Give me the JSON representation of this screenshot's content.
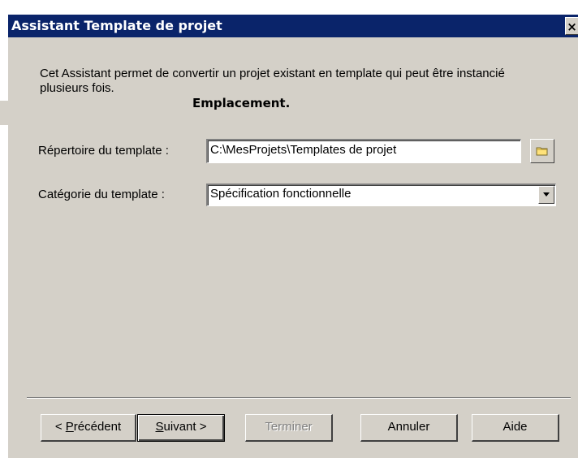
{
  "window": {
    "title": "Assistant Template de projet",
    "close_label": "×"
  },
  "intro": {
    "text": "Cet Assistant permet de convertir un projet existant en template qui peut être instancié plusieurs fois."
  },
  "section": {
    "heading": "Emplacement."
  },
  "form": {
    "directory_label": "Répertoire du template :",
    "directory_value": "C:\\MesProjets\\Templates de projet",
    "category_label": "Catégorie du template :",
    "category_value": "Spécification fonctionnelle"
  },
  "buttons": {
    "previous": {
      "prefix": "< ",
      "mnemonic": "P",
      "rest": "récédent"
    },
    "next": {
      "mnemonic": "S",
      "rest": "uivant >"
    },
    "finish": "Terminer",
    "cancel": "Annuler",
    "help": "Aide"
  },
  "colors": {
    "titlebar": "#0a246a",
    "dialog_face": "#d4d0c8",
    "disabled_text": "#808080"
  },
  "icons": {
    "browse": "folder-icon",
    "dropdown": "chevron-down-icon"
  }
}
